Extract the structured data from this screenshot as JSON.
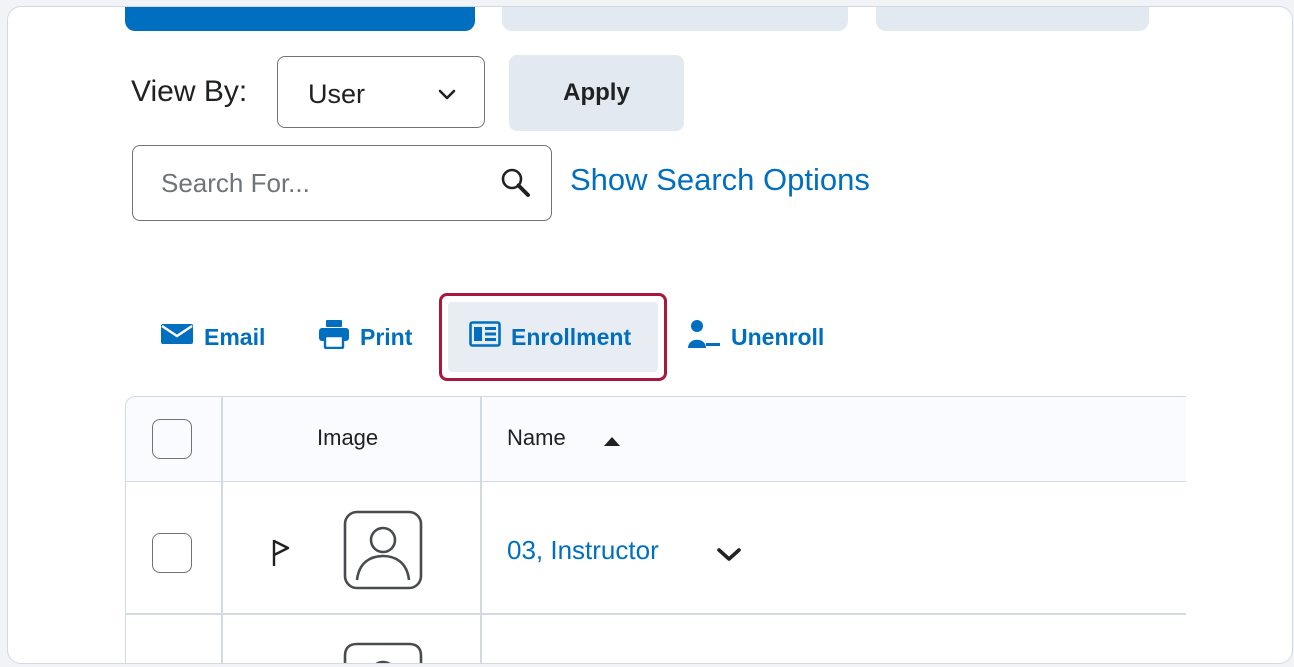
{
  "filters": {
    "view_by_label": "View By:",
    "view_by_value": "User",
    "apply_label": "Apply",
    "search_placeholder": "Search For...",
    "search_options_label": "Show Search Options"
  },
  "actions": {
    "email": "Email",
    "print": "Print",
    "enrollment": "Enrollment",
    "unenroll": "Unenroll"
  },
  "table": {
    "columns": [
      "",
      "Image",
      "Name"
    ],
    "sort": "ascending",
    "rows": [
      {
        "name": "03, Instructor"
      }
    ]
  },
  "colors": {
    "link": "#006fbf",
    "highlight": "#a6193d",
    "button_bg": "#e3e9f1"
  }
}
